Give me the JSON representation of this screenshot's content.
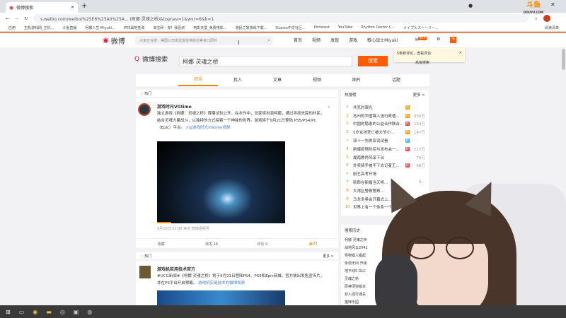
{
  "browser": {
    "tab_title": "微博搜索",
    "url": "s.weibo.com/weibo/%25E6%25A0%25A... (柯娜 灵魂之桥)&topnav=1&wvr=6&b=1",
    "new_tab": "+",
    "bookmarks": [
      "应用",
      "主机游戏网_主机...",
      "斗鱼直播",
      "柯娜人生 Miyuki...",
      "IP归属地查询",
      "淘宝网 - 淘！我喜欢",
      "电影天堂_免费电影...",
      "游民之家游戏下载...",
      "Illusion中文社区...",
      "Pinterest",
      "YouTube",
      "Rhythm Doctor C...",
      "メイプルストーリー...",
      "阅读清单"
    ]
  },
  "weibo": {
    "logo": "微博",
    "search_placeholder": "大家正在搜：美国公司发送首批特斯拉等进口原料",
    "nav": [
      "首页",
      "视频",
      "发现",
      "游戏",
      "敏心战士Miyuki"
    ],
    "msg_badge": "99+",
    "tip": "5条新评论，查看评论",
    "tip_sub": "高级搜索",
    "search_title": "微博搜索",
    "query": "柯娜 灵魂之桥",
    "search_btn": "搜索",
    "tabs": [
      "综合",
      "找人",
      "文章",
      "视频",
      "图片",
      "话题"
    ],
    "hot_label": "热门",
    "more": "更多 >",
    "posts": [
      {
        "author": "游戏时光VGtime",
        "text": "独立游戏《柯娜：灵魂之桥》首曝试玩公开。在本作中，玩家将扮演柯娜，通过寻找失踪的村民，结合灵魂力量战斗，以独特的方式探索一个神秘的世界。游戏将于9月21日登陆 PS5/PS4/PC（Epic）平台。",
        "link": "//@游戏时光VGtime视频",
        "meta": "9月20日 21:08 来自 微博视频号",
        "actions": [
          "收藏",
          "转发 16",
          "评论 9",
          "22"
        ]
      },
      {
        "author": "游戏机实用技术官方",
        "text": "#UCG新闻#《柯娜 灵魂之桥》将于9月21日登陆PS4、PS5和Epic商城，官方放出发售宣传片，并在PS平台开启预载。",
        "link": "游戏机实用技术的微博视频"
      }
    ],
    "sidebar": {
      "hot_title": "热搜榜",
      "more": "更多 >",
      "trends": [
        {
          "n": "↑",
          "t": "共克时艰光",
          "b": "热",
          "c": "#ff9406",
          "v": ""
        },
        {
          "n": "1",
          "t": "苏州的华国锋入选行政值...",
          "b": "热",
          "c": "#ff9406",
          "v": "330万"
        },
        {
          "n": "2",
          "t": "中国的隐患的公益合作联合...",
          "b": "新",
          "c": "#e13d3d",
          "v": "153万"
        },
        {
          "n": "3",
          "t": "5岁女孩死亡被大爷小...",
          "b": "热",
          "c": "#ff9406",
          "v": "147万"
        },
        {
          "n": "•",
          "t": "双十一先刷双试试看",
          "b": "荐",
          "c": "#2ebeea",
          "v": ""
        },
        {
          "n": "4",
          "t": "新疆疫情防控与发布会一...",
          "b": "新",
          "c": "#e13d3d",
          "v": "117万"
        },
        {
          "n": "5",
          "t": "湖南教师风采下台",
          "b": "",
          "c": "",
          "v": "79万"
        },
        {
          "n": "6",
          "t": "外卖骑手被不下去记者王...",
          "b": "新",
          "c": "#e13d3d",
          "v": "68万"
        },
        {
          "n": "•",
          "t": "厨艺高考开场",
          "b": "",
          "c": "",
          "v": ""
        },
        {
          "n": "7",
          "t": "新郎在新婚当天将...",
          "b": "",
          "c": "",
          "v": "6..."
        },
        {
          "n": "8",
          "t": "大湾区警察警察...",
          "b": "",
          "c": "",
          "v": ""
        },
        {
          "n": "9",
          "t": "马龙冬奥会开幕式上...",
          "b": "",
          "c": "",
          "v": ""
        },
        {
          "n": "10",
          "t": "世界上有一个体系一个...",
          "b": "",
          "c": "",
          "v": ""
        }
      ],
      "history_title": "搜索历史",
      "history": [
        "柯娜 灵魂之桥",
        "战地风云2042",
        "怪物猎人崛起",
        "永劫无间 升级",
        "地平线5 DLC",
        "灵魂之桥",
        "原神须弥版本",
        "双人成行通关",
        "猫咪乐园"
      ]
    }
  },
  "overlay": {
    "logo_text": "斗鱼",
    "logo_sub": "DOUYU.COM"
  },
  "colors": {
    "accent": "#ff5b00",
    "weibo_orange": "#e8874b",
    "taskbar": "#3a3a3a"
  }
}
